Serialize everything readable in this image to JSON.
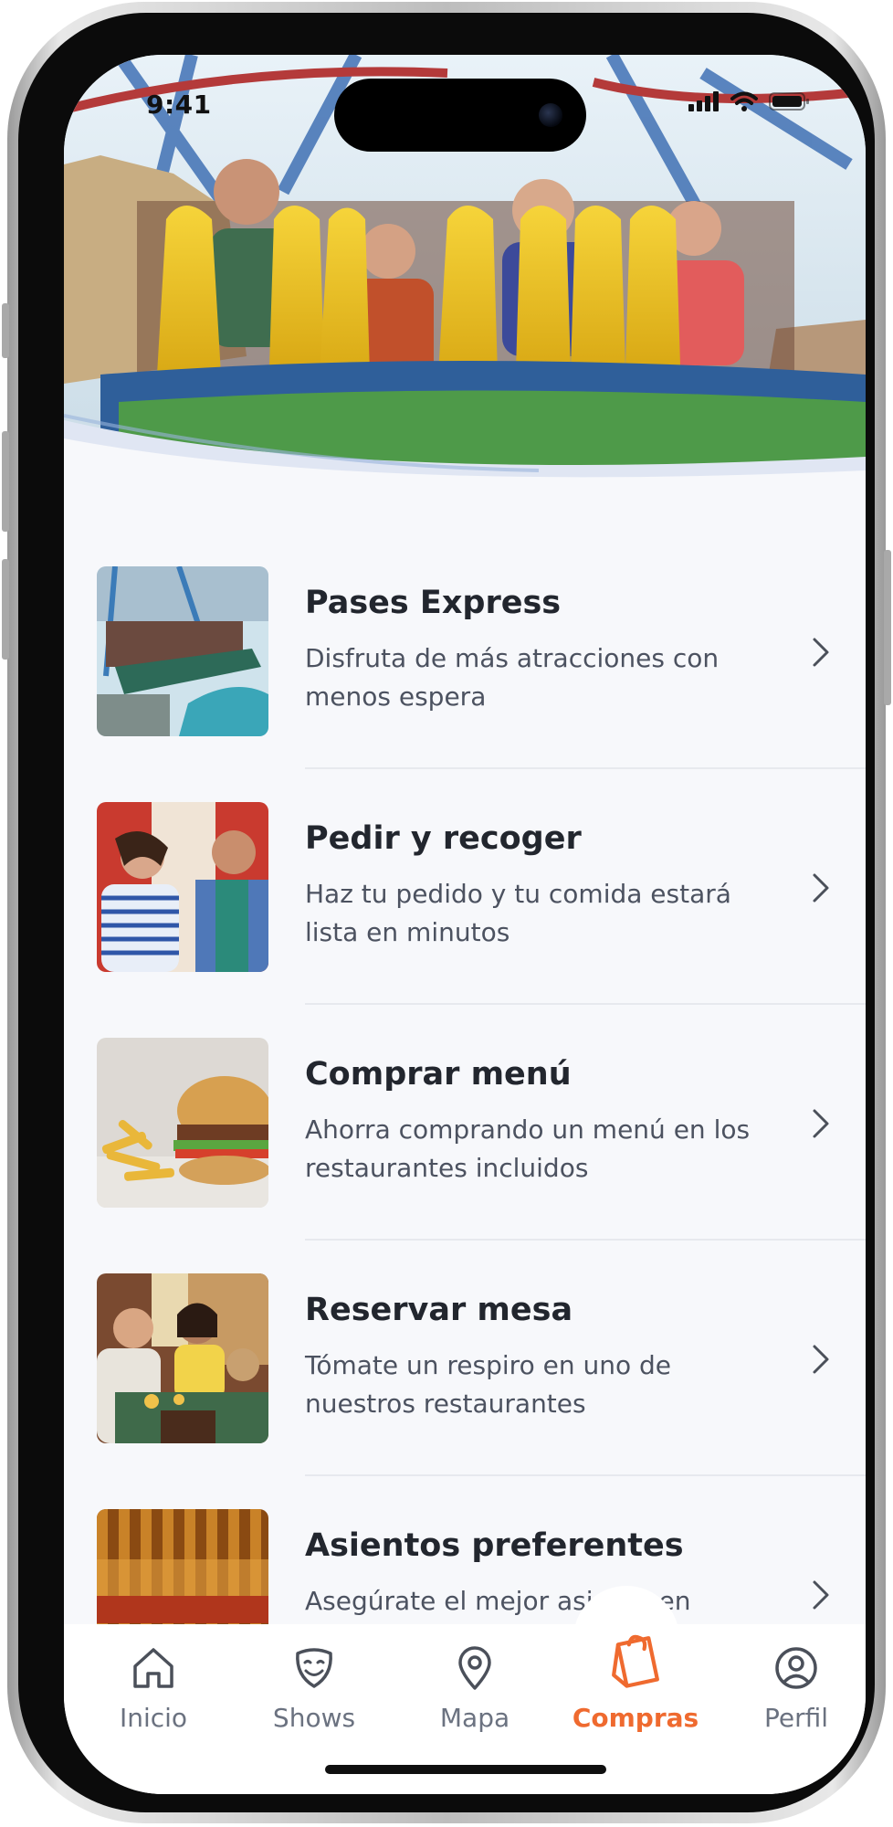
{
  "status_bar": {
    "time": "9:41"
  },
  "menu": [
    {
      "title": "Pases Express",
      "description": "Disfruta de más atracciones con menos espera",
      "image": "rollercoaster-photo"
    },
    {
      "title": "Pedir y recoger",
      "description": "Haz tu pedido y tu comida estará lista en minutos",
      "image": "couple-eating-photo"
    },
    {
      "title": "Comprar menú",
      "description": "Ahorra comprando un menú en los restaurantes incluidos",
      "image": "burger-fries-photo"
    },
    {
      "title": "Reservar mesa",
      "description": "Tómate un respiro en uno de nuestros restaurantes",
      "image": "family-dinner-photo"
    },
    {
      "title": "Asientos preferentes",
      "description": "Asegúrate el mejor asiento en",
      "image": "theater-curtain-photo"
    }
  ],
  "tabs": [
    {
      "label": "Inicio",
      "icon": "home-icon",
      "active": false
    },
    {
      "label": "Shows",
      "icon": "theater-mask-icon",
      "active": false
    },
    {
      "label": "Mapa",
      "icon": "map-pin-icon",
      "active": false
    },
    {
      "label": "Compras",
      "icon": "shopping-bag-icon",
      "active": true
    },
    {
      "label": "Perfil",
      "icon": "user-circle-icon",
      "active": false
    }
  ],
  "colors": {
    "accent": "#ef6a2f",
    "text_dark": "#22262e",
    "text_muted": "#4c5260",
    "background": "#f7f8fb"
  }
}
